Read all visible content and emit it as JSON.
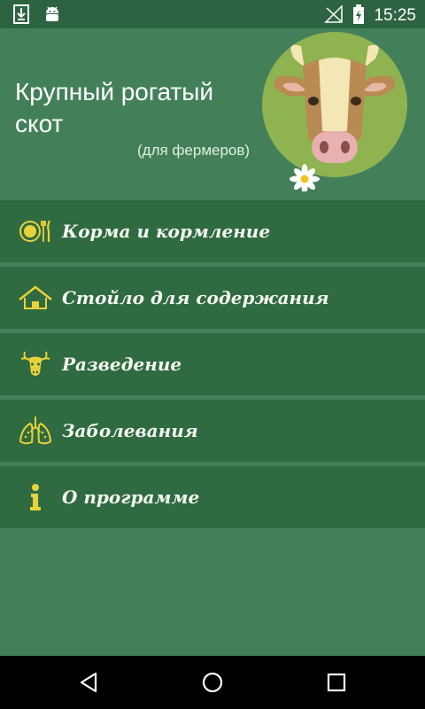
{
  "status_bar": {
    "time": "15:25",
    "icons": [
      "download-icon",
      "android-debug-icon",
      "no-signal-icon",
      "battery-charging-icon"
    ]
  },
  "header": {
    "title": "Крупный рогатый скот",
    "subtitle": "(для фермеров)",
    "logo": "cow-logo-icon"
  },
  "menu": {
    "items": [
      {
        "label": "Корма и кормление",
        "icon": "plate-cutlery-icon"
      },
      {
        "label": "Стойло для содержания",
        "icon": "house-icon"
      },
      {
        "label": "Разведение",
        "icon": "cow-head-icon"
      },
      {
        "label": "Заболевания",
        "icon": "lungs-icon"
      },
      {
        "label": "О программе",
        "icon": "info-icon"
      }
    ]
  },
  "nav_bar": {
    "buttons": [
      "back-icon",
      "home-icon",
      "recents-icon"
    ]
  },
  "colors": {
    "background": "#43805a",
    "menu_item": "#2f6a40",
    "status_bar": "#2d6343",
    "icon_yellow": "#e8d23a",
    "nav_bar": "#000000"
  }
}
